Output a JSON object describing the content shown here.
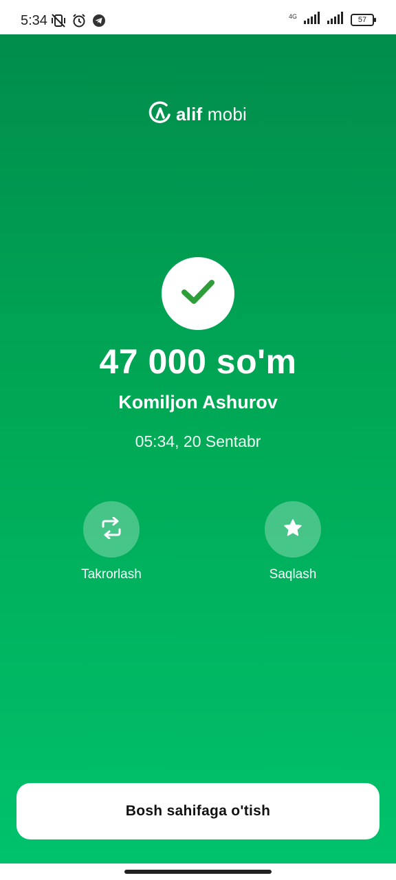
{
  "status_bar": {
    "time": "5:34",
    "network_label_top": "4G",
    "network_label_bottom": "4G",
    "battery_level": "57",
    "icons": [
      "vibrate-off-icon",
      "alarm-icon",
      "telegram-icon",
      "signal-icon",
      "signal-icon"
    ]
  },
  "app": {
    "logo_bold": "alif",
    "logo_regular": " mobi"
  },
  "payment": {
    "status_icon": "check-icon",
    "amount": "47 000 so'm",
    "recipient": "Komiljon Ashurov",
    "datetime": "05:34, 20 Sentabr"
  },
  "actions": [
    {
      "label": "Takrorlash",
      "icon": "repeat-icon"
    },
    {
      "label": "Saqlash",
      "icon": "star-icon"
    }
  ],
  "footer": {
    "home_button_label": "Bosh sahifaga o'tish"
  },
  "colors": {
    "gradient_top": "#008d4c",
    "gradient_bottom": "#00c26c",
    "check": "#2f9e3a"
  }
}
